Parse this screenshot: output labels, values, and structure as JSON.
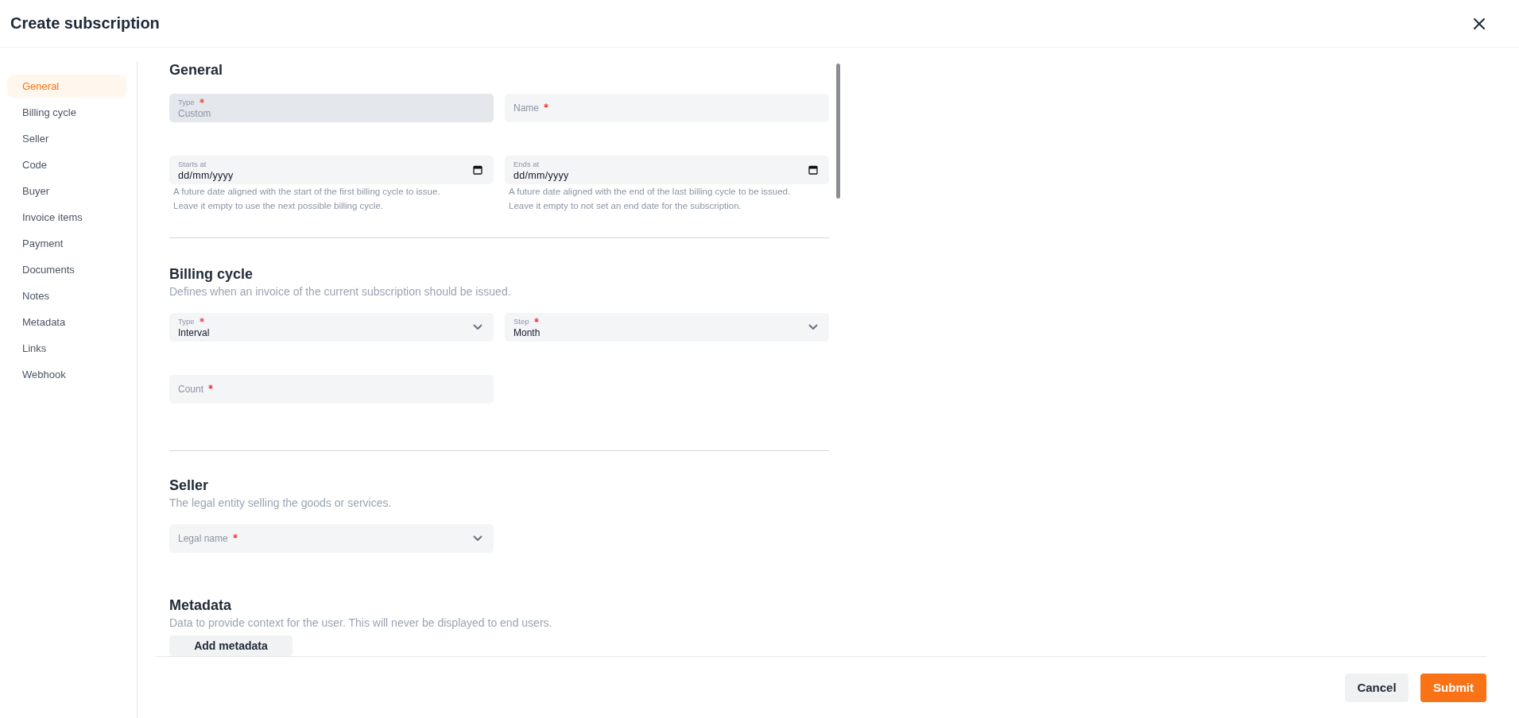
{
  "dialog": {
    "title": "Create subscription"
  },
  "sidebar": {
    "items": [
      {
        "label": "General",
        "selected": true
      },
      {
        "label": "Billing cycle",
        "selected": false
      },
      {
        "label": "Seller",
        "selected": false
      },
      {
        "label": "Code",
        "selected": false
      },
      {
        "label": "Buyer",
        "selected": false
      },
      {
        "label": "Invoice items",
        "selected": false
      },
      {
        "label": "Payment",
        "selected": false
      },
      {
        "label": "Documents",
        "selected": false
      },
      {
        "label": "Notes",
        "selected": false
      },
      {
        "label": "Metadata",
        "selected": false
      },
      {
        "label": "Links",
        "selected": false
      },
      {
        "label": "Webhook",
        "selected": false
      }
    ]
  },
  "sections": [
    {
      "heading": "General",
      "divider": true,
      "fields": [
        {
          "kind": "text",
          "label": "Type",
          "required": true,
          "disabled": true,
          "value": "Custom"
        },
        {
          "kind": "text",
          "label": "Name",
          "required": true,
          "disabled": false
        },
        {
          "kind": "date",
          "label": "Starts at",
          "required": false,
          "disabled": false,
          "value": "dd/mm/yyyy",
          "hint": "A future date aligned with the start of the first billing cycle to issue.\nLeave it empty to use the next possible billing cycle."
        },
        {
          "kind": "date",
          "label": "Ends at",
          "required": false,
          "disabled": false,
          "value": "dd/mm/yyyy",
          "hint": "A future date aligned with the end of the last billing cycle to be issued.\nLeave it empty to not set an end date for the subscription."
        }
      ]
    },
    {
      "heading": "Billing cycle",
      "description": "Defines when an invoice of the current subscription should be issued.",
      "divider": true,
      "fields": [
        {
          "kind": "select",
          "label": "Type",
          "required": true,
          "disabled": false,
          "value": "Interval"
        },
        {
          "kind": "select",
          "label": "Step",
          "required": true,
          "disabled": false,
          "value": "Month"
        },
        {
          "kind": "text",
          "label": "Count",
          "required": true,
          "disabled": false
        }
      ]
    },
    {
      "heading": "Seller",
      "description": "The legal entity selling the goods or services.",
      "divider": false,
      "fields": [
        {
          "kind": "select",
          "label": "Legal name",
          "required": true,
          "disabled": false
        }
      ]
    },
    {
      "heading": "Metadata",
      "description": "Data to provide context for the user. This will never be displayed to end users.",
      "divider": false,
      "button": "Add metadata"
    }
  ],
  "footer": {
    "buttons": [
      {
        "label": "Cancel",
        "kind": "secondary"
      },
      {
        "label": "Submit",
        "kind": "primary"
      }
    ]
  }
}
